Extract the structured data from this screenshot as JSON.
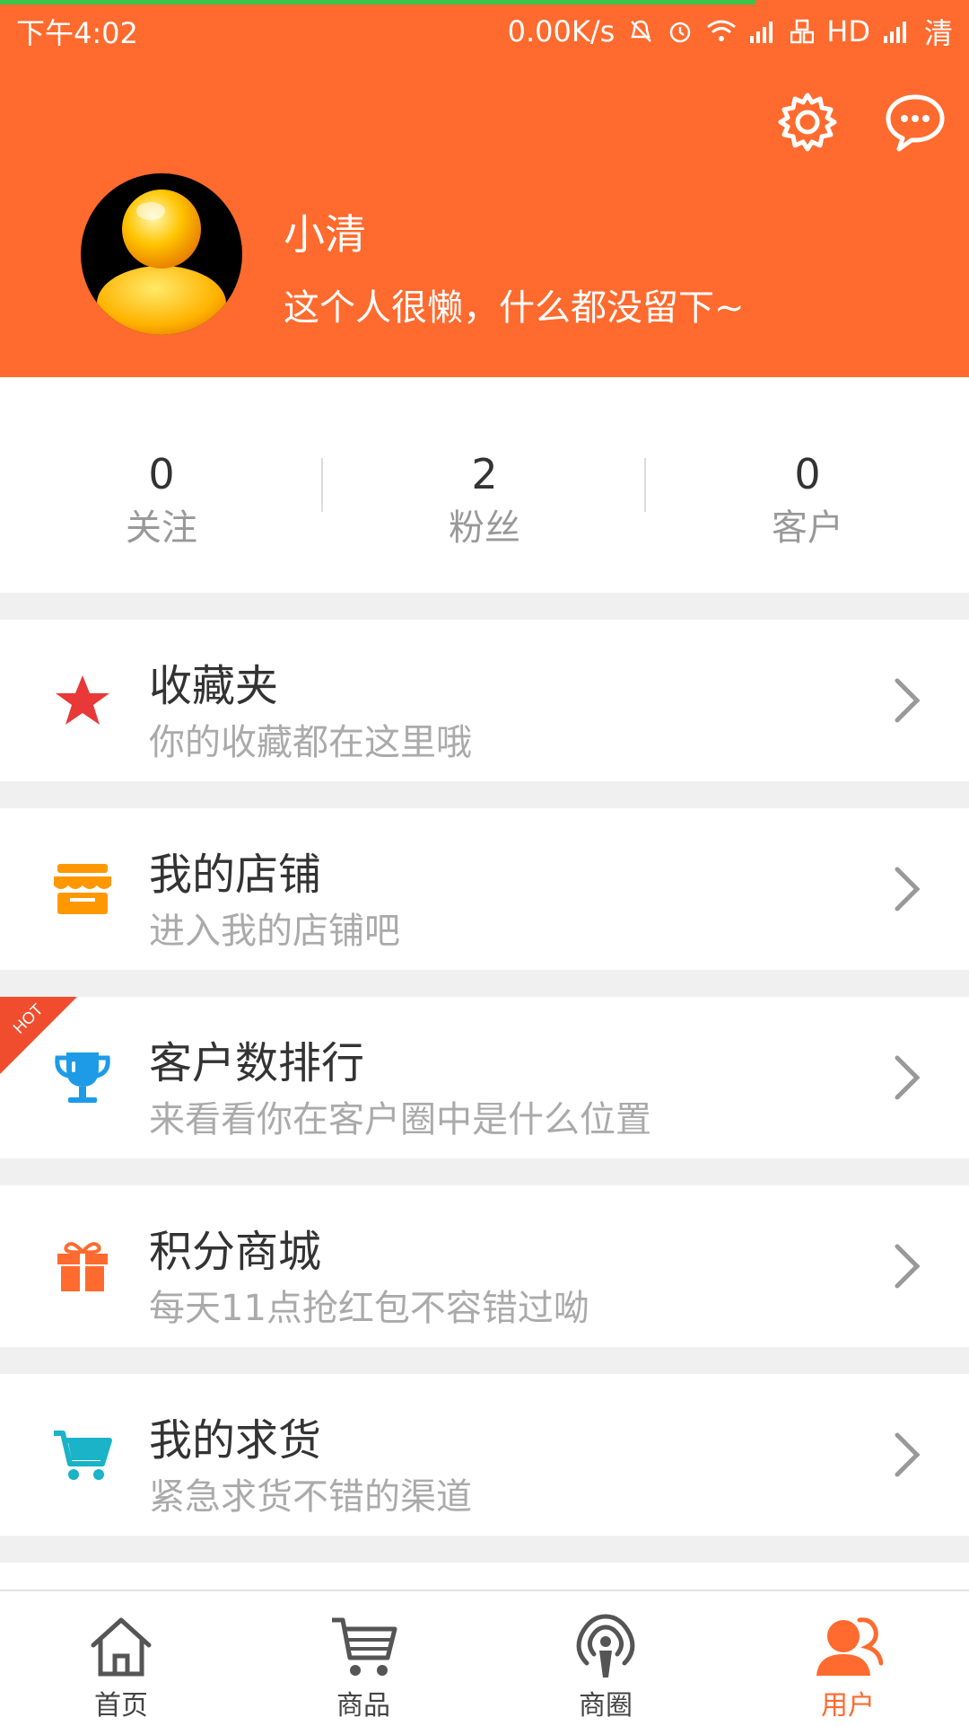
{
  "status_bar": {
    "time": "下午4:02",
    "net_speed": "0.00K/s",
    "carrier1": "HD",
    "carrier2": "清"
  },
  "profile": {
    "name": "小清",
    "bio": "这个人很懒，什么都没留下~"
  },
  "stats": [
    {
      "value": "0",
      "label": "关注"
    },
    {
      "value": "2",
      "label": "粉丝"
    },
    {
      "value": "0",
      "label": "客户"
    }
  ],
  "menu": [
    {
      "title": "收藏夹",
      "subtitle": "你的收藏都在这里哦",
      "icon": "star-icon",
      "color": "#e83838"
    },
    {
      "title": "我的店铺",
      "subtitle": "进入我的店铺吧",
      "icon": "store-icon",
      "color": "#ff9800"
    },
    {
      "title": "客户数排行",
      "subtitle": "来看看你在客户圈中是什么位置",
      "icon": "trophy-icon",
      "color": "#1e9be6",
      "badge": "HOT"
    },
    {
      "title": "积分商城",
      "subtitle": "每天11点抢红包不容错过呦",
      "icon": "gift-icon",
      "color": "#ff6a2e"
    },
    {
      "title": "我的求货",
      "subtitle": "紧急求货不错的渠道",
      "icon": "cart-icon",
      "color": "#1ab3c8"
    }
  ],
  "bottom_nav": [
    {
      "label": "首页",
      "icon": "home-icon"
    },
    {
      "label": "商品",
      "icon": "cart-icon"
    },
    {
      "label": "商圈",
      "icon": "broadcast-icon"
    },
    {
      "label": "用户",
      "icon": "user-icon",
      "active": true
    }
  ],
  "colors": {
    "brand": "#ff6a2e",
    "background": "#f0f0f0"
  }
}
